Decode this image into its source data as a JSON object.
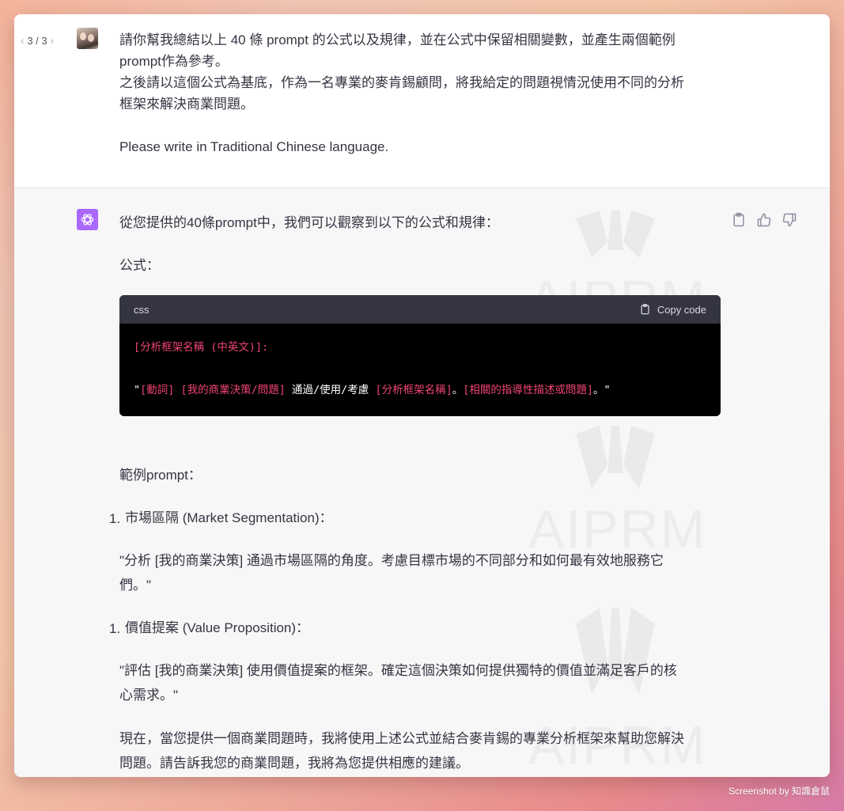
{
  "user": {
    "pager": {
      "prev_icon": "chevron-left",
      "label": "3 / 3",
      "next_icon": "chevron-right"
    },
    "lines": [
      "請你幫我總結以上 40 條 prompt 的公式以及規律，並在公式中保留相關變數，並產生兩個範例",
      "prompt作為參考。",
      "之後請以這個公式為基底，作為一名專業的麥肯錫顧問，將我給定的問題視情況使用不同的分析",
      "框架來解決商業問題。"
    ],
    "language_note": "Please write in Traditional Chinese language."
  },
  "assistant": {
    "intro": "從您提供的40條prompt中，我們可以觀察到以下的公式和規律：",
    "formula_label": "公式：",
    "code": {
      "language": "css",
      "copy_label": "Copy code",
      "line1": "[分析框架名稱 (中英文)]:",
      "line2_q1": "\"",
      "line2_sel1": "[動詞] [我的商業決策/問題]",
      "line2_t1": " 通過/使用/考慮 ",
      "line2_sel2": "[分析框架名稱]",
      "line2_t2": "。",
      "line2_sel3": "[相關的指導性描述或問題]",
      "line2_t3": "。\""
    },
    "examples_label": "範例prompt：",
    "examples": [
      {
        "number": "1.",
        "title": "市場區隔 (Market Segmentation)：",
        "body_line1": "\"分析 [我的商業決策] 通過市場區隔的角度。考慮目標市場的不同部分和如何最有效地服務它",
        "body_line2": "們。\""
      },
      {
        "number": "1.",
        "title": "價值提案 (Value Proposition)：",
        "body_line1": "\"評估 [我的商業決策] 使用價值提案的框架。確定這個決策如何提供獨特的價值並滿足客戶的核",
        "body_line2": "心需求。\""
      }
    ],
    "closing_line1": "現在，當您提供一個商業問題時，我將使用上述公式並結合麥肯錫的專業分析框架來幫助您解決",
    "closing_line2": "問題。請告訴我您的商業問題，我將為您提供相應的建議。",
    "action_icons": [
      "clipboard-icon",
      "thumbs-up-icon",
      "thumbs-down-icon"
    ],
    "watermark": "AIPRM"
  },
  "credit": "Screenshot by 知識倉鼠",
  "colors": {
    "accent": "#ab68ff",
    "code_highlight": "#ef4474",
    "code_header": "#343541"
  }
}
